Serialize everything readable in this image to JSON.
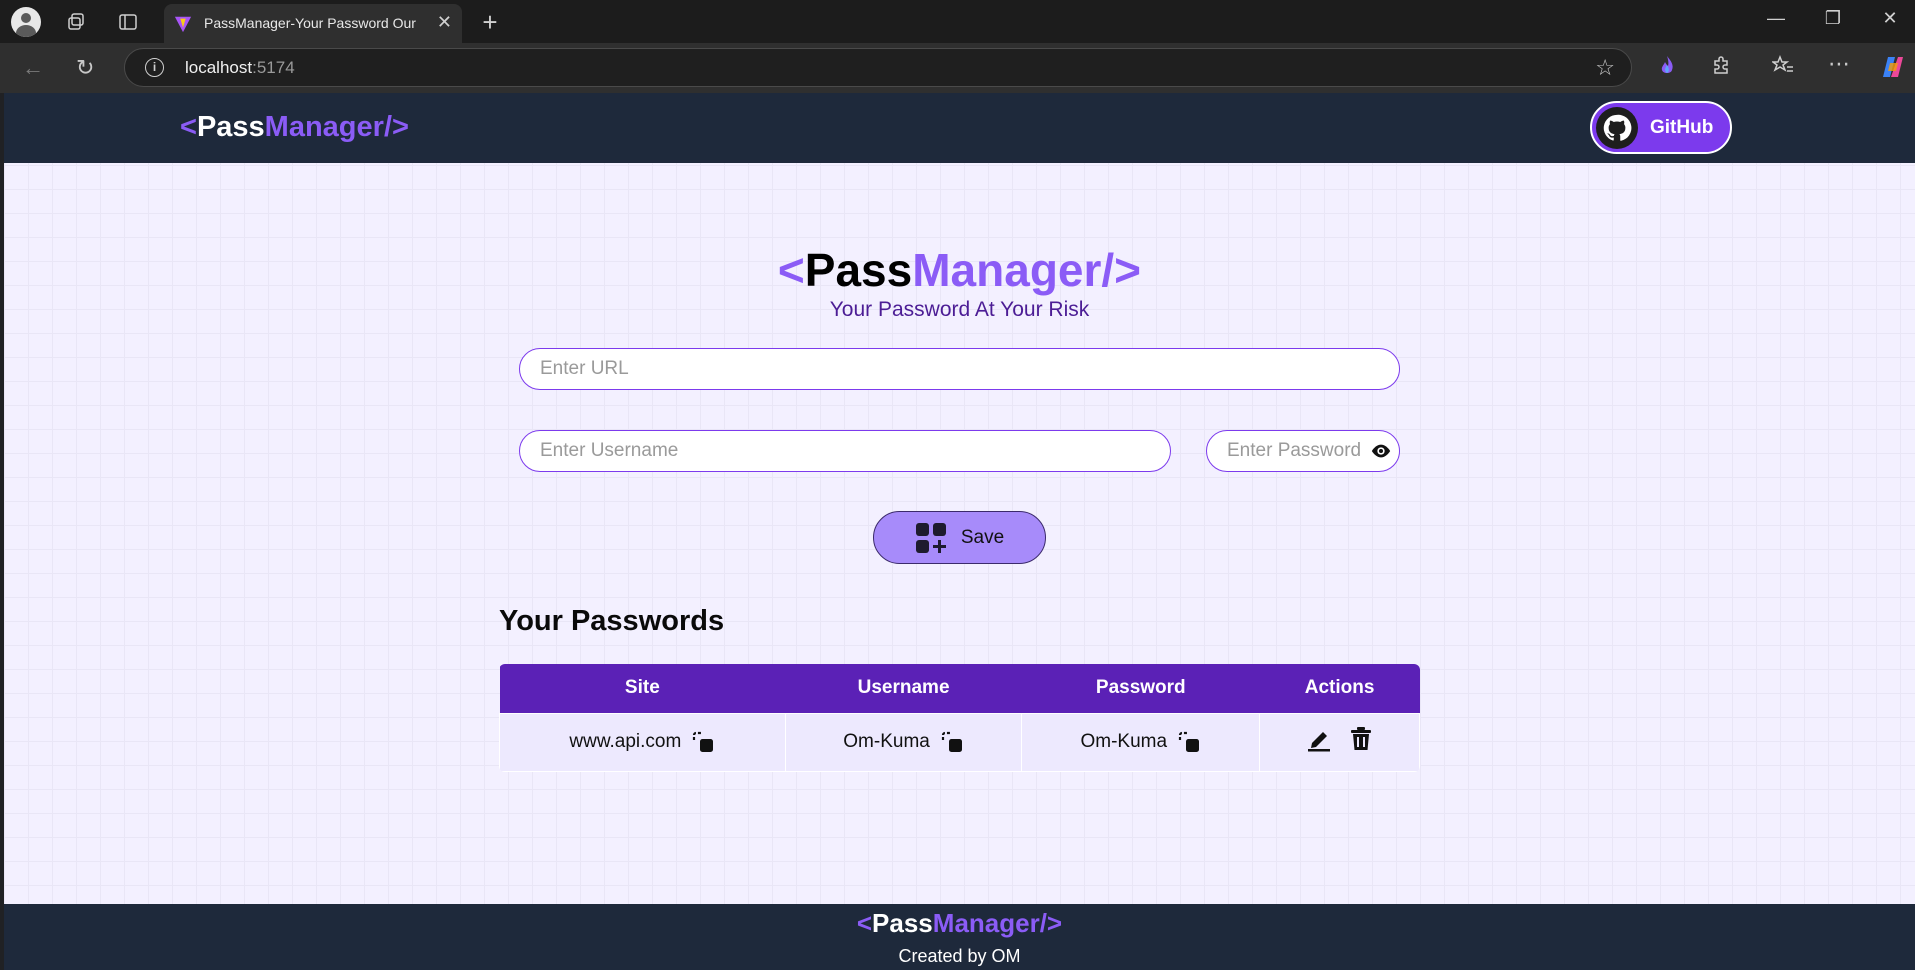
{
  "browser": {
    "tab_title": "PassManager-Your Password Our",
    "url_host": "localhost",
    "url_port": ":5174"
  },
  "navbar": {
    "logo": {
      "open": "<",
      "pass": "Pass",
      "manager": "Manager",
      "close": "/>"
    },
    "github_label": "GitHub"
  },
  "hero": {
    "logo": {
      "open": "<",
      "pass": "Pass",
      "manager": "Manager",
      "close": "/>"
    },
    "tagline": "Your Password At Your Risk"
  },
  "form": {
    "url_placeholder": "Enter URL",
    "username_placeholder": "Enter Username",
    "password_placeholder": "Enter Password",
    "save_label": "Save"
  },
  "passwords": {
    "title": "Your Passwords",
    "headers": [
      "Site",
      "Username",
      "Password",
      "Actions"
    ],
    "rows": [
      {
        "site": "www.api.com",
        "username": "Om-Kuma",
        "password": "Om-Kuma"
      }
    ]
  },
  "footer": {
    "logo": {
      "open": "<",
      "pass": "Pass",
      "manager": "Manager",
      "close": "/>"
    },
    "credit": "Created by OM"
  },
  "colors": {
    "brand": "#8b5cf6",
    "navbar_bg": "#1e293b",
    "table_header": "#5b21b6",
    "table_row": "#ede9fe",
    "save_button": "#a78bfa"
  },
  "icons": {
    "github": "github-icon",
    "eye": "eye-icon",
    "save": "add-grid-icon",
    "copy": "copy-icon",
    "edit": "edit-icon",
    "delete": "trash-icon"
  }
}
